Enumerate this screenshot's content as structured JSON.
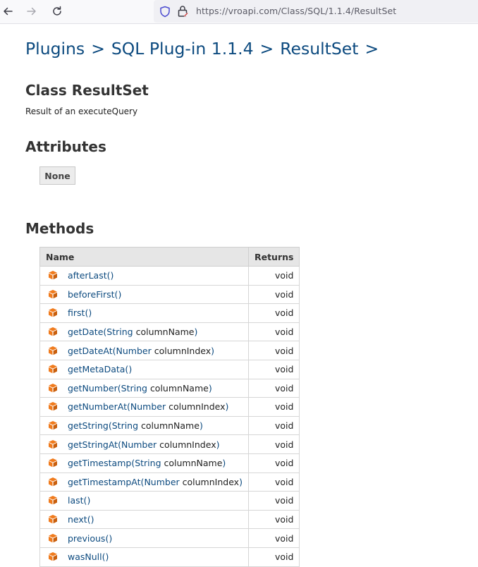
{
  "browser": {
    "url": "https://vroapi.com/Class/SQL/1.1.4/ResultSet"
  },
  "breadcrumb": {
    "items": [
      "Plugins",
      "SQL Plug-in 1.1.4",
      "ResultSet"
    ],
    "separator": ">"
  },
  "class": {
    "title": "Class ResultSet",
    "description": "Result of an executeQuery"
  },
  "attributes": {
    "heading": "Attributes",
    "none_label": "None"
  },
  "methods": {
    "heading": "Methods",
    "columns": [
      "Name",
      "Returns"
    ],
    "rows": [
      {
        "name": "afterLast",
        "param_type": "",
        "param_name": "",
        "returns": "void"
      },
      {
        "name": "beforeFirst",
        "param_type": "",
        "param_name": "",
        "returns": "void"
      },
      {
        "name": "first",
        "param_type": "",
        "param_name": "",
        "returns": "void"
      },
      {
        "name": "getDate",
        "param_type": "String",
        "param_name": "columnName",
        "returns": "void"
      },
      {
        "name": "getDateAt",
        "param_type": "Number",
        "param_name": "columnIndex",
        "returns": "void"
      },
      {
        "name": "getMetaData",
        "param_type": "",
        "param_name": "",
        "returns": "void"
      },
      {
        "name": "getNumber",
        "param_type": "String",
        "param_name": "columnName",
        "returns": "void"
      },
      {
        "name": "getNumberAt",
        "param_type": "Number",
        "param_name": "columnIndex",
        "returns": "void"
      },
      {
        "name": "getString",
        "param_type": "String",
        "param_name": "columnName",
        "returns": "void"
      },
      {
        "name": "getStringAt",
        "param_type": "Number",
        "param_name": "columnIndex",
        "returns": "void"
      },
      {
        "name": "getTimestamp",
        "param_type": "String",
        "param_name": "columnName",
        "returns": "void"
      },
      {
        "name": "getTimestampAt",
        "param_type": "Number",
        "param_name": "columnIndex",
        "returns": "void"
      },
      {
        "name": "last",
        "param_type": "",
        "param_name": "",
        "returns": "void"
      },
      {
        "name": "next",
        "param_type": "",
        "param_name": "",
        "returns": "void"
      },
      {
        "name": "previous",
        "param_type": "",
        "param_name": "",
        "returns": "void"
      },
      {
        "name": "wasNull",
        "param_type": "",
        "param_name": "",
        "returns": "void"
      }
    ],
    "icon": "method-cube-icon"
  },
  "colors": {
    "link": "#0c4a7f",
    "method_icon": "#f07b1d"
  }
}
